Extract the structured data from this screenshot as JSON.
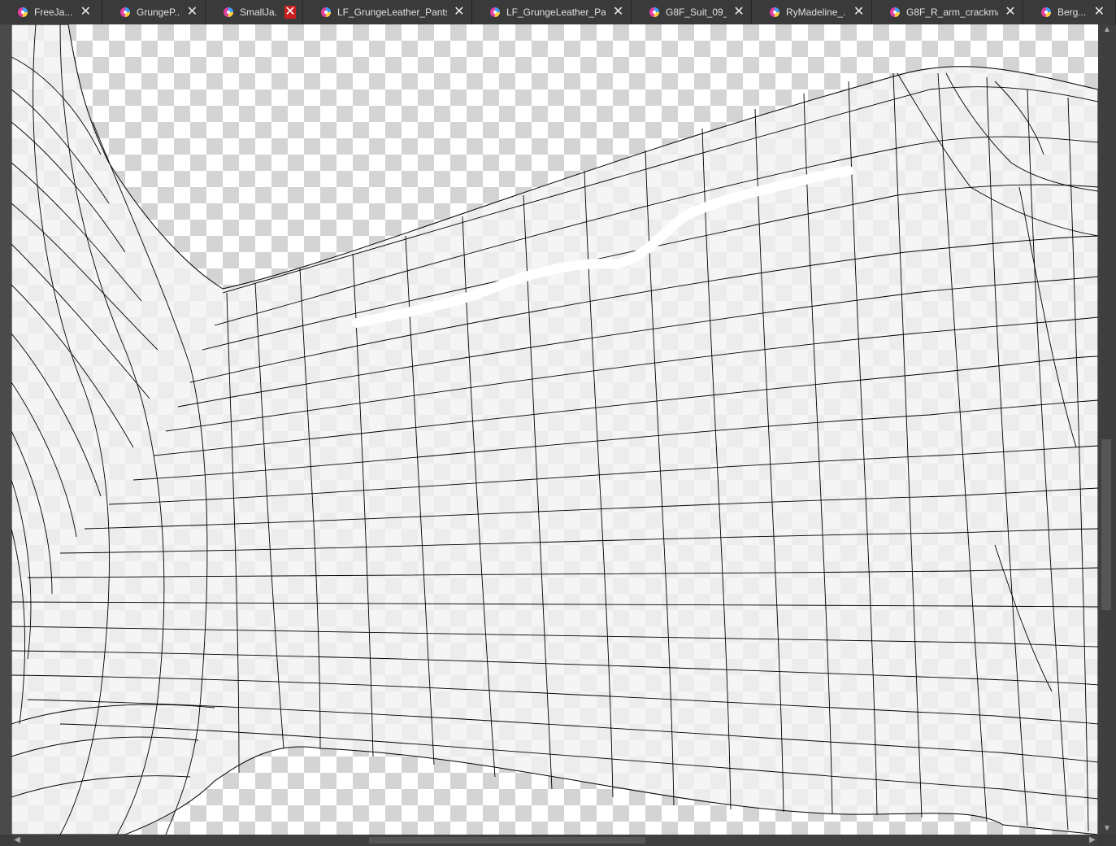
{
  "tabs": [
    {
      "title": "FreeJa..."
    },
    {
      "title": "GrungeP..."
    },
    {
      "title": "SmallJa..."
    },
    {
      "title": "LF_GrungeLeather_Pants..."
    },
    {
      "title": "LF_GrungeLeather_Pa..."
    },
    {
      "title": "G8F_Suit_09_..."
    },
    {
      "title": "RyMadeline_..."
    },
    {
      "title": "G8F_R_arm_crackma..."
    },
    {
      "title": "Berg..."
    }
  ],
  "close_glyph": "✕",
  "active_tab_index": 2,
  "colors": {
    "active_close": "#c81e1e",
    "checker_light": "#ffffff",
    "checker_dark": "#d4d4d4",
    "mesh_fill": "#f2f2f2",
    "mesh_line": "#000000",
    "brush_stroke": "#ffffff"
  },
  "icons": {
    "tab_icon": "document-color-wheel-icon",
    "close": "close-icon"
  }
}
